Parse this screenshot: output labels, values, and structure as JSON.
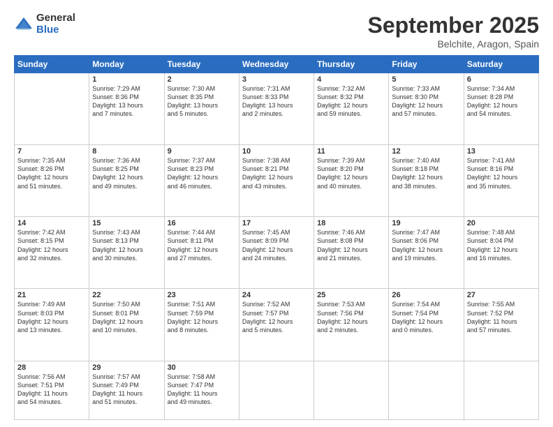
{
  "logo": {
    "general": "General",
    "blue": "Blue"
  },
  "title": {
    "month": "September 2025",
    "location": "Belchite, Aragon, Spain"
  },
  "weekdays": [
    "Sunday",
    "Monday",
    "Tuesday",
    "Wednesday",
    "Thursday",
    "Friday",
    "Saturday"
  ],
  "weeks": [
    [
      {
        "day": "",
        "info": ""
      },
      {
        "day": "1",
        "info": "Sunrise: 7:29 AM\nSunset: 8:36 PM\nDaylight: 13 hours\nand 7 minutes."
      },
      {
        "day": "2",
        "info": "Sunrise: 7:30 AM\nSunset: 8:35 PM\nDaylight: 13 hours\nand 5 minutes."
      },
      {
        "day": "3",
        "info": "Sunrise: 7:31 AM\nSunset: 8:33 PM\nDaylight: 13 hours\nand 2 minutes."
      },
      {
        "day": "4",
        "info": "Sunrise: 7:32 AM\nSunset: 8:32 PM\nDaylight: 12 hours\nand 59 minutes."
      },
      {
        "day": "5",
        "info": "Sunrise: 7:33 AM\nSunset: 8:30 PM\nDaylight: 12 hours\nand 57 minutes."
      },
      {
        "day": "6",
        "info": "Sunrise: 7:34 AM\nSunset: 8:28 PM\nDaylight: 12 hours\nand 54 minutes."
      }
    ],
    [
      {
        "day": "7",
        "info": "Sunrise: 7:35 AM\nSunset: 8:26 PM\nDaylight: 12 hours\nand 51 minutes."
      },
      {
        "day": "8",
        "info": "Sunrise: 7:36 AM\nSunset: 8:25 PM\nDaylight: 12 hours\nand 49 minutes."
      },
      {
        "day": "9",
        "info": "Sunrise: 7:37 AM\nSunset: 8:23 PM\nDaylight: 12 hours\nand 46 minutes."
      },
      {
        "day": "10",
        "info": "Sunrise: 7:38 AM\nSunset: 8:21 PM\nDaylight: 12 hours\nand 43 minutes."
      },
      {
        "day": "11",
        "info": "Sunrise: 7:39 AM\nSunset: 8:20 PM\nDaylight: 12 hours\nand 40 minutes."
      },
      {
        "day": "12",
        "info": "Sunrise: 7:40 AM\nSunset: 8:18 PM\nDaylight: 12 hours\nand 38 minutes."
      },
      {
        "day": "13",
        "info": "Sunrise: 7:41 AM\nSunset: 8:16 PM\nDaylight: 12 hours\nand 35 minutes."
      }
    ],
    [
      {
        "day": "14",
        "info": "Sunrise: 7:42 AM\nSunset: 8:15 PM\nDaylight: 12 hours\nand 32 minutes."
      },
      {
        "day": "15",
        "info": "Sunrise: 7:43 AM\nSunset: 8:13 PM\nDaylight: 12 hours\nand 30 minutes."
      },
      {
        "day": "16",
        "info": "Sunrise: 7:44 AM\nSunset: 8:11 PM\nDaylight: 12 hours\nand 27 minutes."
      },
      {
        "day": "17",
        "info": "Sunrise: 7:45 AM\nSunset: 8:09 PM\nDaylight: 12 hours\nand 24 minutes."
      },
      {
        "day": "18",
        "info": "Sunrise: 7:46 AM\nSunset: 8:08 PM\nDaylight: 12 hours\nand 21 minutes."
      },
      {
        "day": "19",
        "info": "Sunrise: 7:47 AM\nSunset: 8:06 PM\nDaylight: 12 hours\nand 19 minutes."
      },
      {
        "day": "20",
        "info": "Sunrise: 7:48 AM\nSunset: 8:04 PM\nDaylight: 12 hours\nand 16 minutes."
      }
    ],
    [
      {
        "day": "21",
        "info": "Sunrise: 7:49 AM\nSunset: 8:03 PM\nDaylight: 12 hours\nand 13 minutes."
      },
      {
        "day": "22",
        "info": "Sunrise: 7:50 AM\nSunset: 8:01 PM\nDaylight: 12 hours\nand 10 minutes."
      },
      {
        "day": "23",
        "info": "Sunrise: 7:51 AM\nSunset: 7:59 PM\nDaylight: 12 hours\nand 8 minutes."
      },
      {
        "day": "24",
        "info": "Sunrise: 7:52 AM\nSunset: 7:57 PM\nDaylight: 12 hours\nand 5 minutes."
      },
      {
        "day": "25",
        "info": "Sunrise: 7:53 AM\nSunset: 7:56 PM\nDaylight: 12 hours\nand 2 minutes."
      },
      {
        "day": "26",
        "info": "Sunrise: 7:54 AM\nSunset: 7:54 PM\nDaylight: 12 hours\nand 0 minutes."
      },
      {
        "day": "27",
        "info": "Sunrise: 7:55 AM\nSunset: 7:52 PM\nDaylight: 11 hours\nand 57 minutes."
      }
    ],
    [
      {
        "day": "28",
        "info": "Sunrise: 7:56 AM\nSunset: 7:51 PM\nDaylight: 11 hours\nand 54 minutes."
      },
      {
        "day": "29",
        "info": "Sunrise: 7:57 AM\nSunset: 7:49 PM\nDaylight: 11 hours\nand 51 minutes."
      },
      {
        "day": "30",
        "info": "Sunrise: 7:58 AM\nSunset: 7:47 PM\nDaylight: 11 hours\nand 49 minutes."
      },
      {
        "day": "",
        "info": ""
      },
      {
        "day": "",
        "info": ""
      },
      {
        "day": "",
        "info": ""
      },
      {
        "day": "",
        "info": ""
      }
    ]
  ]
}
